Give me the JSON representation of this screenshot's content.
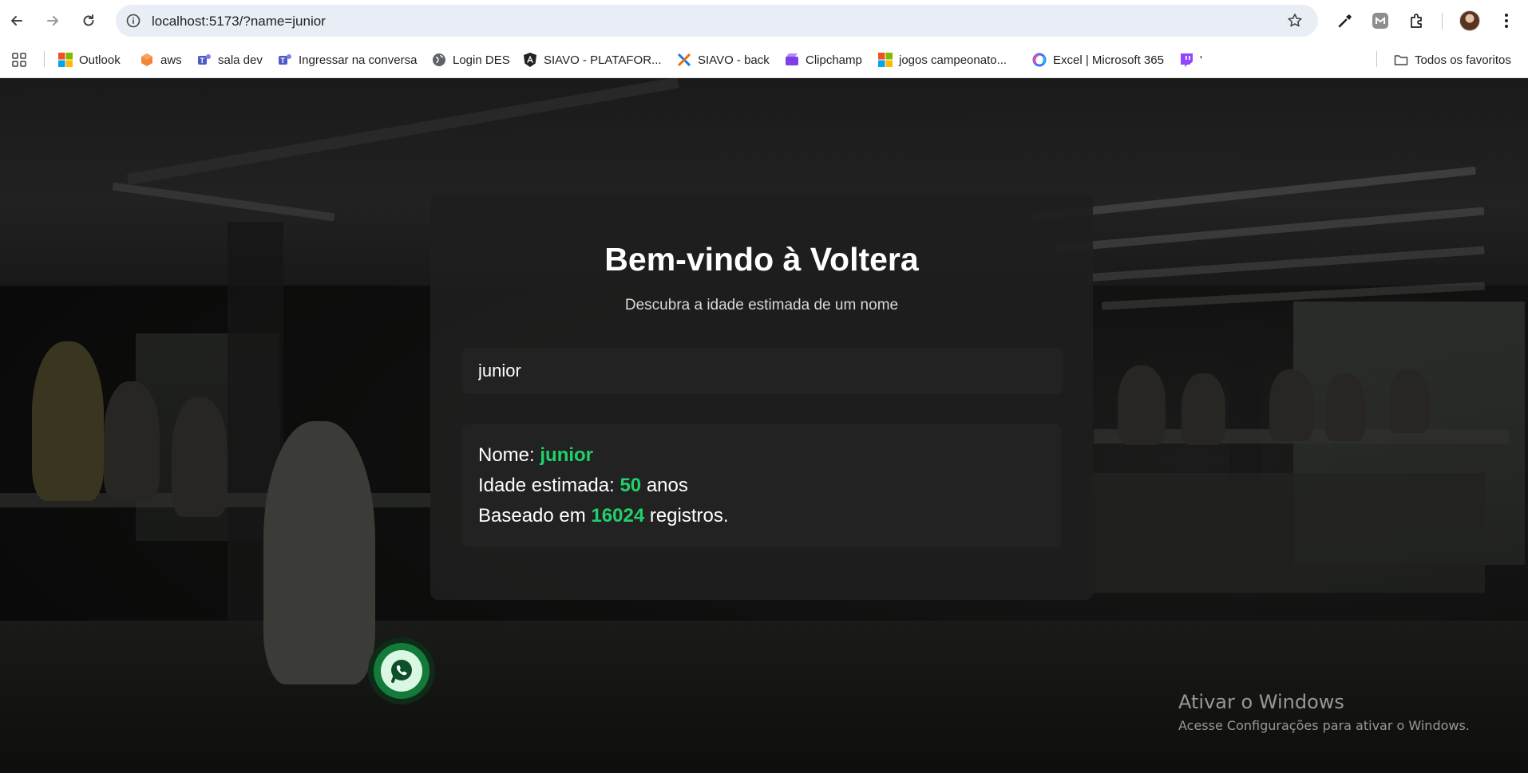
{
  "browser": {
    "url": "localhost:5173/?name=junior",
    "bookmarks": [
      {
        "label": "Outlook",
        "icon": "microsoft-icon"
      },
      {
        "label": "aws",
        "icon": "aws-icon"
      },
      {
        "label": "sala dev",
        "icon": "teams-icon"
      },
      {
        "label": "Ingressar na conversa",
        "icon": "teams-icon"
      },
      {
        "label": "Login DES",
        "icon": "globe-icon"
      },
      {
        "label": "SIAVO - PLATAFOR...",
        "icon": "angular-icon"
      },
      {
        "label": "SIAVO - back",
        "icon": "x-icon"
      },
      {
        "label": "Clipchamp",
        "icon": "clipchamp-icon"
      },
      {
        "label": "jogos campeonato...",
        "icon": "microsoft-icon"
      },
      {
        "label": "Excel | Microsoft 365",
        "icon": "copilot-icon"
      },
      {
        "label": "'",
        "icon": "twitch-icon"
      }
    ],
    "all_bookmarks_label": "Todos os favoritos"
  },
  "card": {
    "title": "Bem-vindo à Voltera",
    "subtitle": "Descubra a idade estimada de um nome",
    "input_value": "junior",
    "result": {
      "name_label": "Nome: ",
      "name_value": "junior",
      "age_label": "Idade estimada: ",
      "age_value": "50",
      "age_unit": " anos",
      "count_label": "Baseado em ",
      "count_value": "16024",
      "count_suffix": " registros."
    }
  },
  "watermark": {
    "title": "Ativar o Windows",
    "subtitle": "Acesse Configurações para ativar o Windows."
  },
  "colors": {
    "accent": "#1fd16b",
    "card_bg": "#1e1e1e",
    "whatsapp": "#147a3a"
  }
}
